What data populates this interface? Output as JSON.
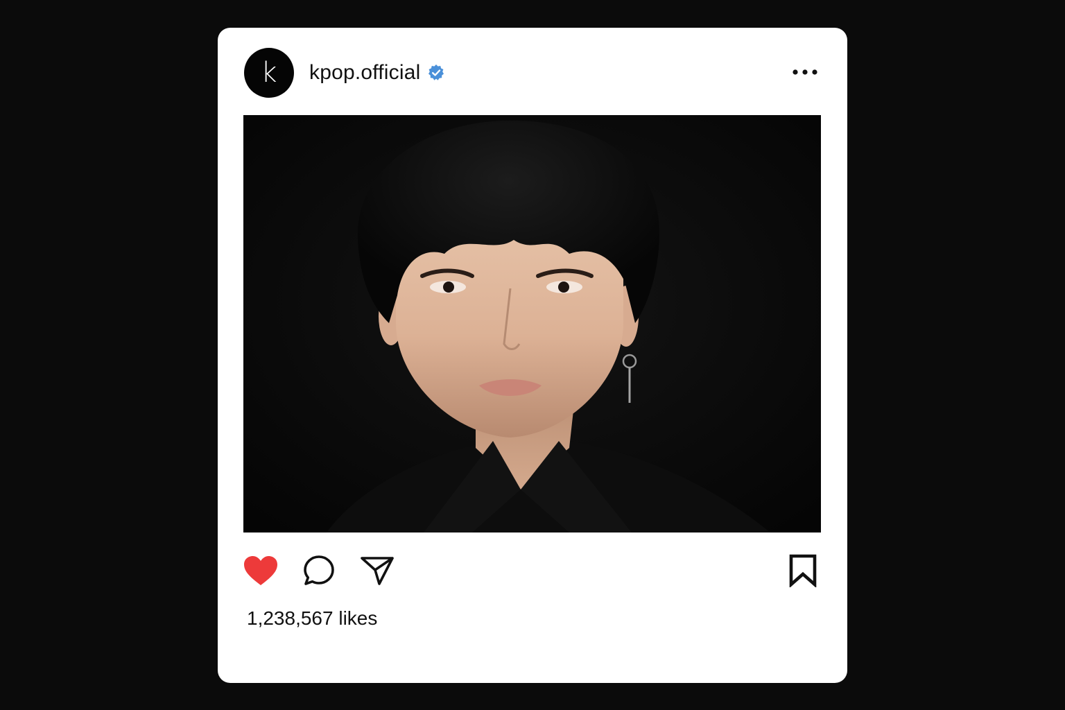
{
  "post": {
    "username": "kpop.official",
    "avatar_letter": "k",
    "verified": true,
    "verified_color": "#4a90d9",
    "image_alt": "",
    "liked": true,
    "like_color": "#ed3a3a",
    "likes_text": "1,238,567 likes"
  },
  "icons": {
    "more": "more-options-icon",
    "like": "heart-icon",
    "comment": "comment-icon",
    "share": "send-icon",
    "save": "bookmark-icon",
    "verified": "verified-badge-icon"
  }
}
